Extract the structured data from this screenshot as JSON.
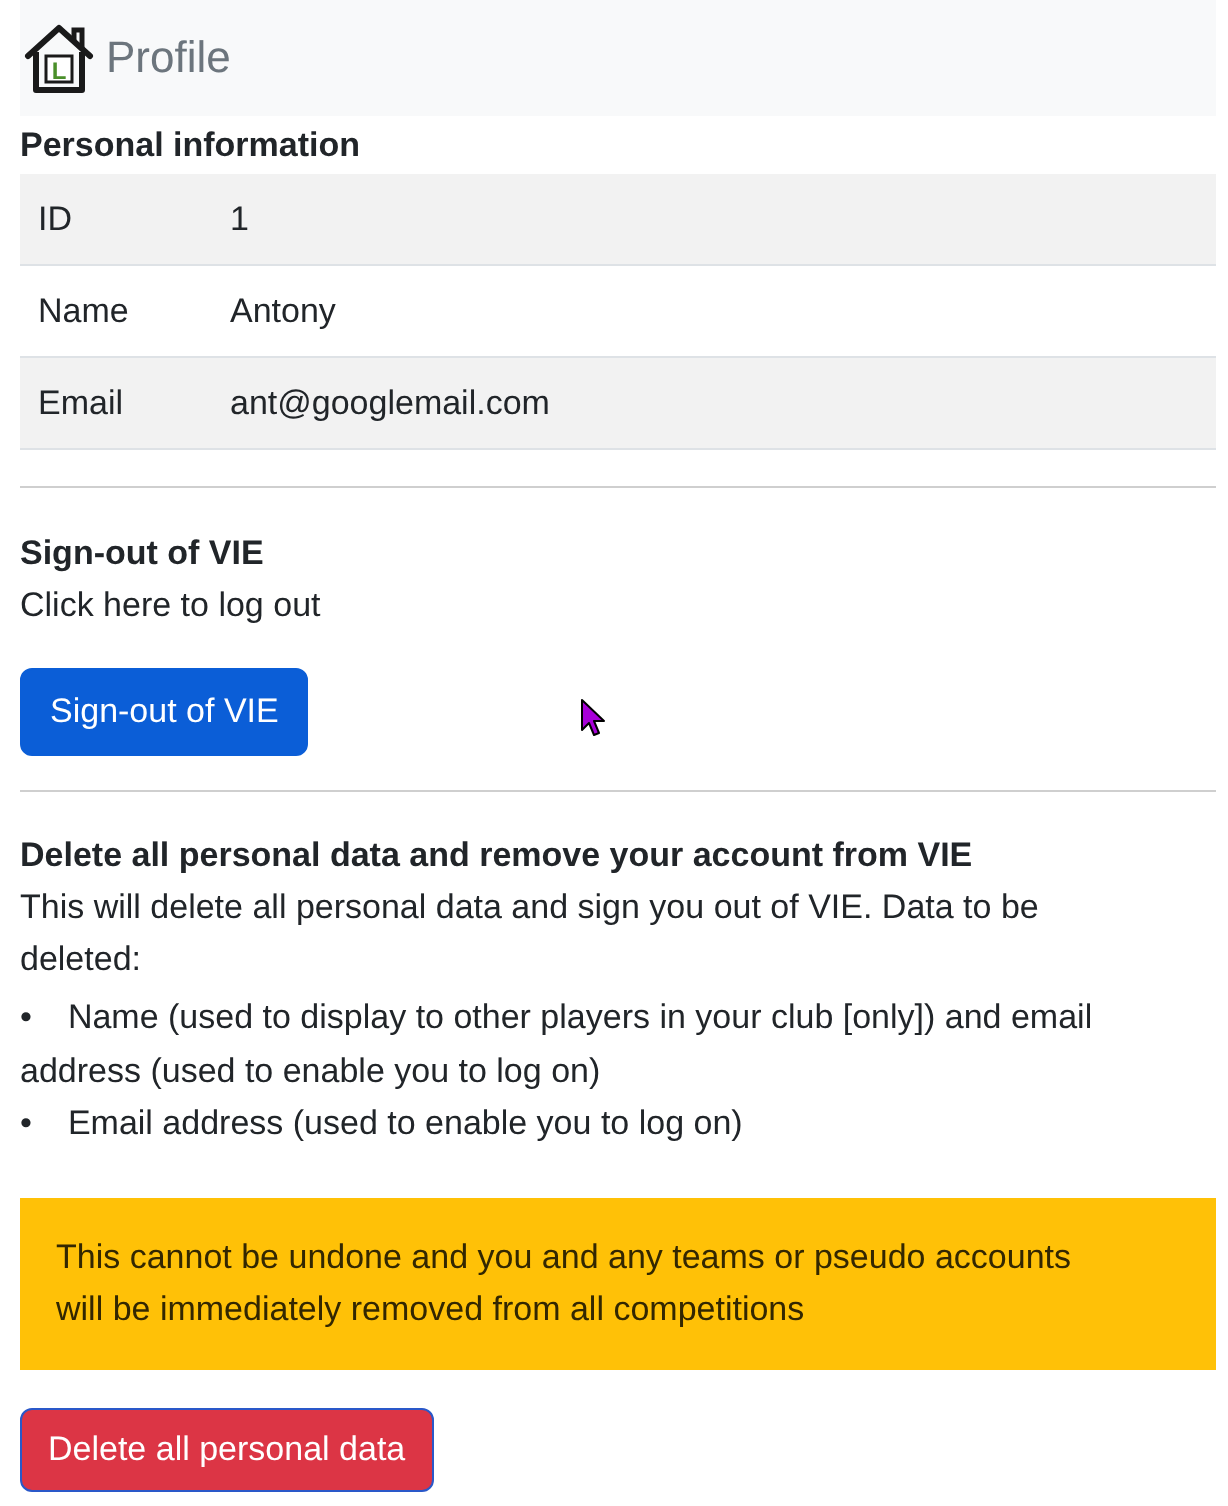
{
  "navbar": {
    "logo_letter": "L",
    "title": "Profile"
  },
  "personal_information": {
    "heading": "Personal information",
    "rows": [
      {
        "label": "ID",
        "value": "1"
      },
      {
        "label": "Name",
        "value": "Antony"
      },
      {
        "label": "Email",
        "value": "ant@googlemail.com"
      }
    ]
  },
  "sign_out": {
    "heading": "Sign-out of VIE",
    "text": "Click here to log out",
    "button": "Sign-out of VIE"
  },
  "delete_account": {
    "heading": "Delete all personal data and remove your account from VIE",
    "text": "This will delete all personal data and sign you out of VIE. Data to be deleted:",
    "items": [
      {
        "bullet": "•",
        "text": "Name (used to display to other players in your club [only]) and email address (used to enable you to log on)"
      },
      {
        "bullet": "•",
        "text": "Email address (used to enable you to log on)"
      }
    ],
    "warning": "This cannot be undone and you and any teams or pseudo accounts will be immediately removed from all competitions",
    "button": "Delete all personal data"
  }
}
